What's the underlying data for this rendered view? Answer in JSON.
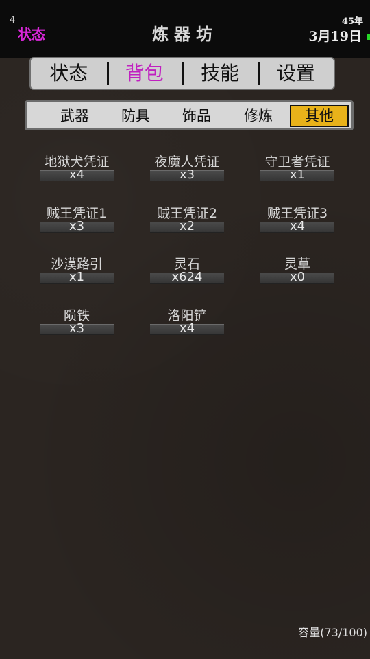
{
  "topbar": {
    "number": "4",
    "status_label": "状态",
    "title": "炼器坊",
    "year": "45年",
    "date": "3月19日"
  },
  "main_tabs": [
    {
      "label": "状态",
      "active": false
    },
    {
      "label": "背包",
      "active": true
    },
    {
      "label": "技能",
      "active": false
    },
    {
      "label": "设置",
      "active": false
    }
  ],
  "sub_tabs": [
    {
      "label": "武器",
      "active": false
    },
    {
      "label": "防具",
      "active": false
    },
    {
      "label": "饰品",
      "active": false
    },
    {
      "label": "修炼",
      "active": false
    },
    {
      "label": "其他",
      "active": true
    }
  ],
  "items": [
    {
      "name": "地狱犬凭证",
      "count": "x4"
    },
    {
      "name": "夜魔人凭证",
      "count": "x3"
    },
    {
      "name": "守卫者凭证",
      "count": "x1"
    },
    {
      "name": "贼王凭证1",
      "count": "x3"
    },
    {
      "name": "贼王凭证2",
      "count": "x2"
    },
    {
      "name": "贼王凭证3",
      "count": "x4"
    },
    {
      "name": "沙漠路引",
      "count": "x1"
    },
    {
      "name": "灵石",
      "count": "x624"
    },
    {
      "name": "灵草",
      "count": "x0"
    },
    {
      "name": "陨铁",
      "count": "x3"
    },
    {
      "name": "洛阳铲",
      "count": "x4"
    }
  ],
  "capacity": "容量(73/100)",
  "colors": {
    "accent_magenta": "#c020c0",
    "active_subtab": "#e8b21a",
    "date_indicator": "#27d827"
  }
}
